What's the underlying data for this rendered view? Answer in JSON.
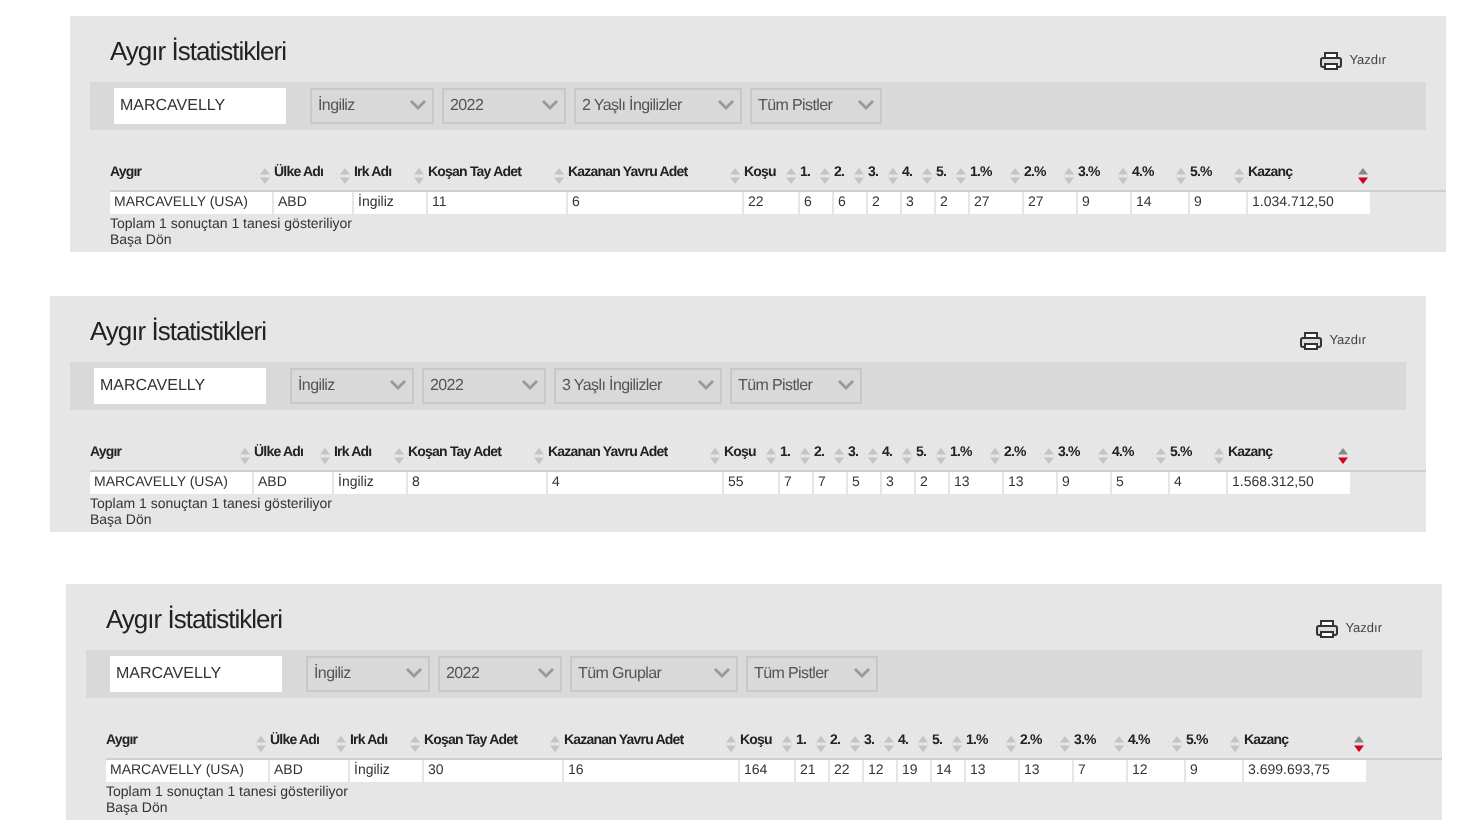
{
  "panels": [
    {
      "title": "Aygır İstatistikleri",
      "print_label": "Yazdır",
      "search": {
        "value": "MARCAVELLY"
      },
      "filters": [
        "İngiliz",
        "2022",
        "2 Yaşlı İngilizler",
        "Tüm Pistler"
      ],
      "columns": [
        {
          "label": "Aygır",
          "sorted": false
        },
        {
          "label": "Ülke Adı",
          "sorted": false
        },
        {
          "label": "Irk Adı",
          "sorted": false
        },
        {
          "label": "Koşan Tay Adet",
          "sorted": false
        },
        {
          "label": "Kazanan Yavru Adet",
          "sorted": false
        },
        {
          "label": "Koşu",
          "sorted": false
        },
        {
          "label": "1.",
          "sorted": false
        },
        {
          "label": "2.",
          "sorted": false
        },
        {
          "label": "3.",
          "sorted": false
        },
        {
          "label": "4.",
          "sorted": false
        },
        {
          "label": "5.",
          "sorted": false
        },
        {
          "label": "1.%",
          "sorted": false
        },
        {
          "label": "2.%",
          "sorted": false
        },
        {
          "label": "3.%",
          "sorted": false
        },
        {
          "label": "4.%",
          "sorted": false
        },
        {
          "label": "5.%",
          "sorted": false
        },
        {
          "label": "Kazanç",
          "sorted": true
        }
      ],
      "rows": [
        [
          "MARCAVELLY (USA)",
          "ABD",
          "İngiliz",
          "11",
          "6",
          "22",
          "6",
          "6",
          "2",
          "3",
          "2",
          "27",
          "27",
          "9",
          "14",
          "9",
          "1.034.712,50"
        ]
      ],
      "summary": "Toplam 1 sonuçtan 1 tanesi gösteriliyor",
      "back_link": "Başa Dön"
    },
    {
      "title": "Aygır İstatistikleri",
      "print_label": "Yazdır",
      "search": {
        "value": "MARCAVELLY"
      },
      "filters": [
        "İngiliz",
        "2022",
        "3 Yaşlı İngilizler",
        "Tüm Pistler"
      ],
      "columns": [
        {
          "label": "Aygır",
          "sorted": false
        },
        {
          "label": "Ülke Adı",
          "sorted": false
        },
        {
          "label": "Irk Adı",
          "sorted": false
        },
        {
          "label": "Koşan Tay Adet",
          "sorted": false
        },
        {
          "label": "Kazanan Yavru Adet",
          "sorted": false
        },
        {
          "label": "Koşu",
          "sorted": false
        },
        {
          "label": "1.",
          "sorted": false
        },
        {
          "label": "2.",
          "sorted": false
        },
        {
          "label": "3.",
          "sorted": false
        },
        {
          "label": "4.",
          "sorted": false
        },
        {
          "label": "5.",
          "sorted": false
        },
        {
          "label": "1.%",
          "sorted": false
        },
        {
          "label": "2.%",
          "sorted": false
        },
        {
          "label": "3.%",
          "sorted": false
        },
        {
          "label": "4.%",
          "sorted": false
        },
        {
          "label": "5.%",
          "sorted": false
        },
        {
          "label": "Kazanç",
          "sorted": true
        }
      ],
      "rows": [
        [
          "MARCAVELLY (USA)",
          "ABD",
          "İngiliz",
          "8",
          "4",
          "55",
          "7",
          "7",
          "5",
          "3",
          "2",
          "13",
          "13",
          "9",
          "5",
          "4",
          "1.568.312,50"
        ]
      ],
      "summary": "Toplam 1 sonuçtan 1 tanesi gösteriliyor",
      "back_link": "Başa Dön"
    },
    {
      "title": "Aygır İstatistikleri",
      "print_label": "Yazdır",
      "search": {
        "value": "MARCAVELLY"
      },
      "filters": [
        "İngiliz",
        "2022",
        "Tüm Gruplar",
        "Tüm Pistler"
      ],
      "columns": [
        {
          "label": "Aygır",
          "sorted": false
        },
        {
          "label": "Ülke Adı",
          "sorted": false
        },
        {
          "label": "Irk Adı",
          "sorted": false
        },
        {
          "label": "Koşan Tay Adet",
          "sorted": false
        },
        {
          "label": "Kazanan Yavru Adet",
          "sorted": false
        },
        {
          "label": "Koşu",
          "sorted": false
        },
        {
          "label": "1.",
          "sorted": false
        },
        {
          "label": "2.",
          "sorted": false
        },
        {
          "label": "3.",
          "sorted": false
        },
        {
          "label": "4.",
          "sorted": false
        },
        {
          "label": "5.",
          "sorted": false
        },
        {
          "label": "1.%",
          "sorted": false
        },
        {
          "label": "2.%",
          "sorted": false
        },
        {
          "label": "3.%",
          "sorted": false
        },
        {
          "label": "4.%",
          "sorted": false
        },
        {
          "label": "5.%",
          "sorted": false
        },
        {
          "label": "Kazanç",
          "sorted": true
        }
      ],
      "rows": [
        [
          "MARCAVELLY (USA)",
          "ABD",
          "İngiliz",
          "30",
          "16",
          "164",
          "21",
          "22",
          "12",
          "19",
          "14",
          "13",
          "13",
          "7",
          "12",
          "9",
          "3.699.693,75"
        ]
      ],
      "summary": "Toplam 1 sonuçtan 1 tanesi gösteriliyor",
      "back_link": "Başa Dön"
    }
  ]
}
